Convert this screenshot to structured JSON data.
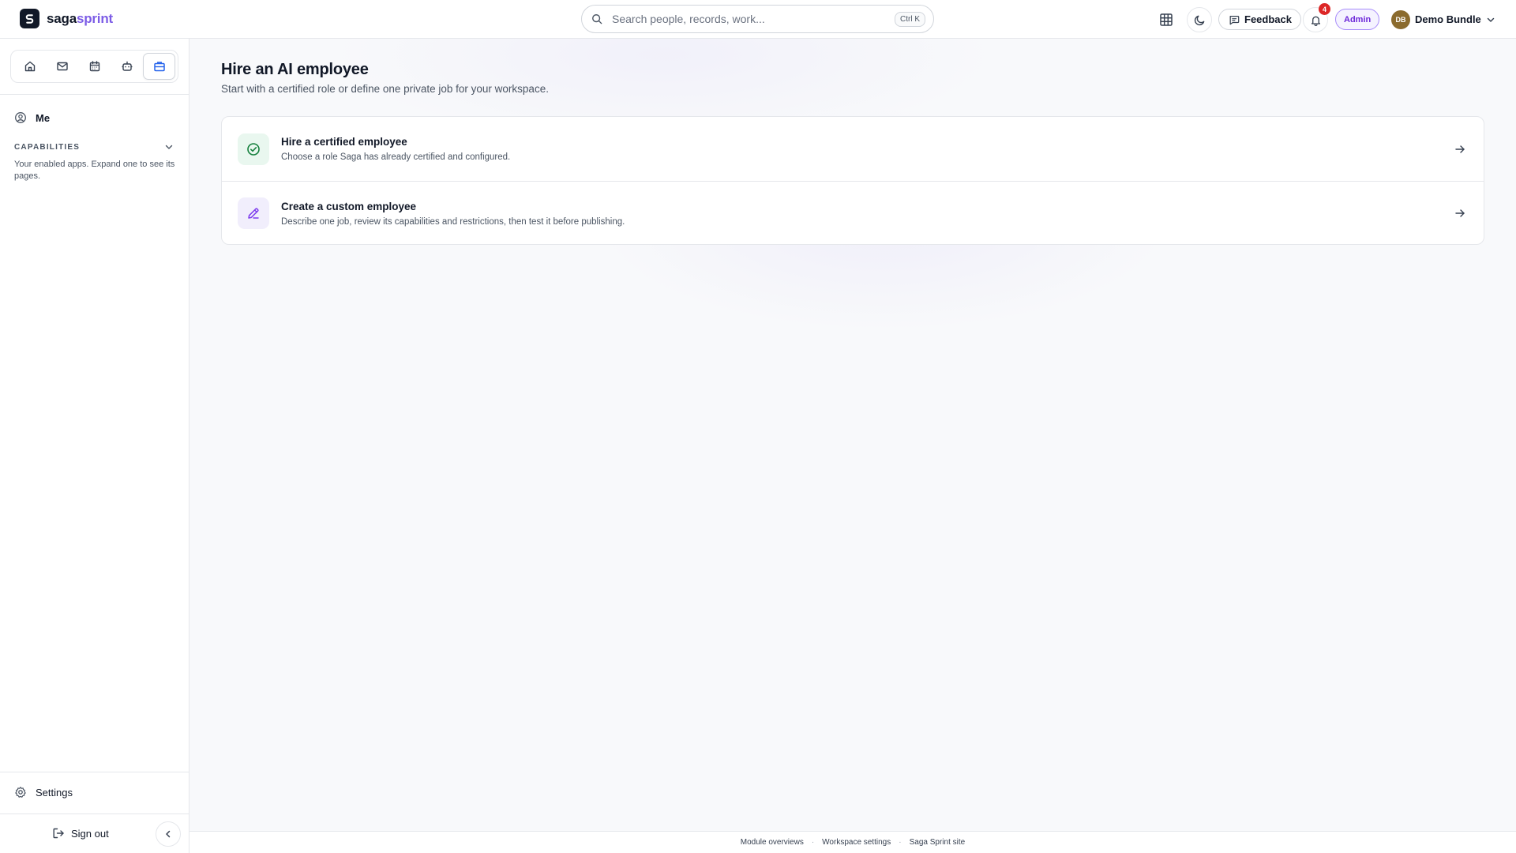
{
  "app": {
    "brand_part1": "saga",
    "brand_part2": "sprint",
    "brand_mark": "S",
    "brand_color": "#7c5ce6"
  },
  "topbar": {
    "search_placeholder": "Search people, records, work...",
    "search_shortcut": "Ctrl K",
    "feedback_label": "Feedback",
    "notifications_count": "4",
    "role_badge": "Admin",
    "user_initials": "DB",
    "user_name": "Demo Bundle"
  },
  "sidebar": {
    "rail_icons": [
      "home-icon",
      "mail-icon",
      "calendar-icon",
      "bot-icon",
      "briefcase-icon"
    ],
    "active_rail_icon": "briefcase-icon",
    "me_label": "Me",
    "capabilities_title": "CAPABILITIES",
    "capabilities_desc": "Your enabled apps. Expand one to see its pages.",
    "settings_label": "Settings",
    "signout_label": "Sign out"
  },
  "main": {
    "title": "Hire an AI employee",
    "subtitle": "Start with a certified role or define one private job for your workspace.",
    "options": [
      {
        "title": "Hire a certified employee",
        "description": "Choose a role Saga has already certified and configured.",
        "icon": "check-circle-icon",
        "icon_color": "#15803d"
      },
      {
        "title": "Create a custom employee",
        "description": "Describe one job, review its capabilities and restrictions, then test it before publishing.",
        "icon": "pencil-icon",
        "icon_color": "#7c3aed"
      }
    ]
  },
  "footer": {
    "links": [
      "Module overviews",
      "Workspace settings",
      "Saga Sprint site"
    ]
  }
}
